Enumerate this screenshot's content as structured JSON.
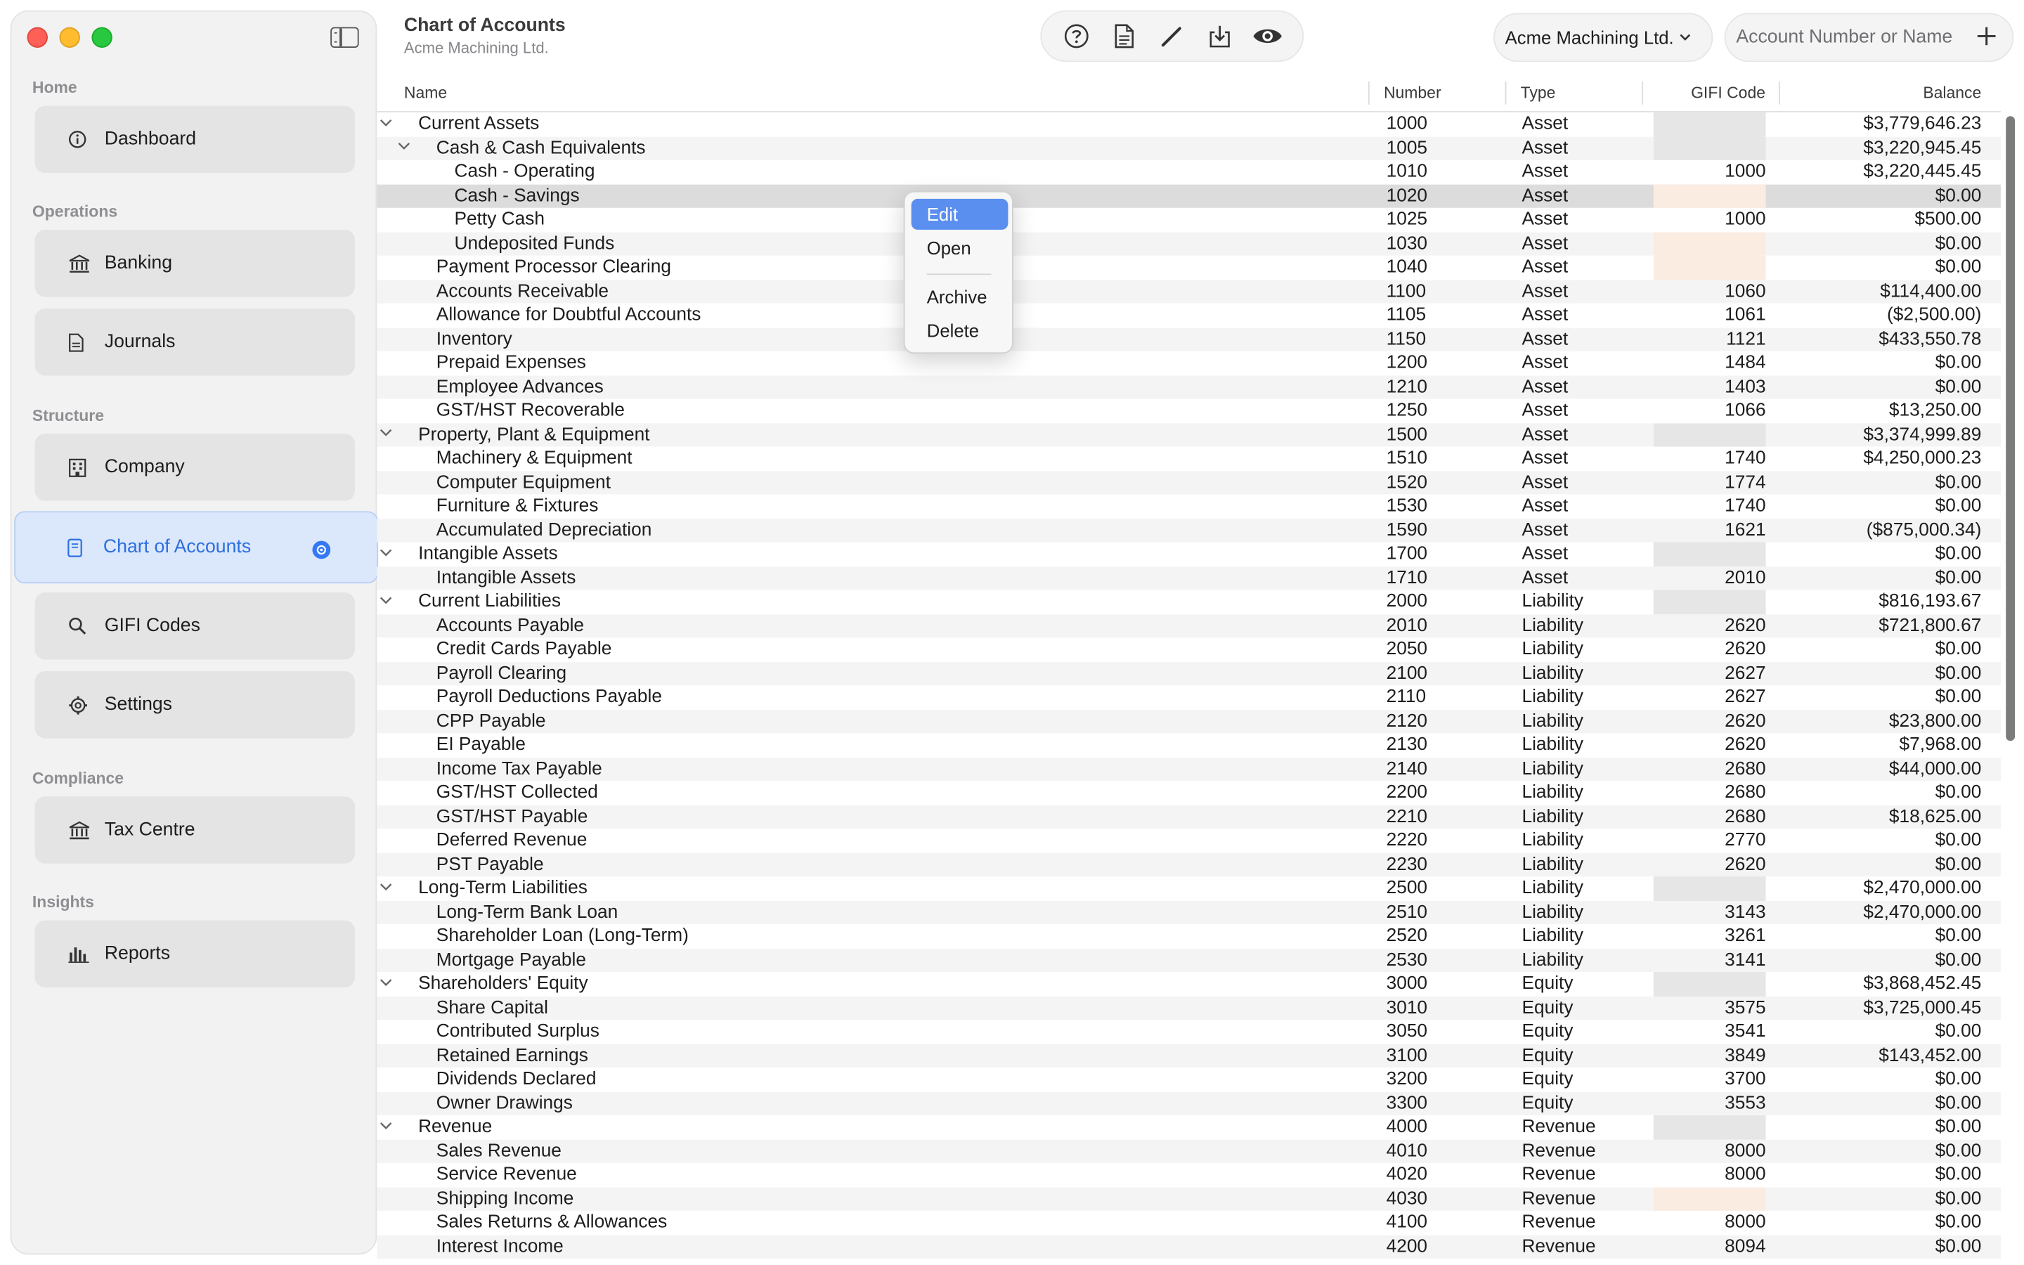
{
  "window": {
    "title": "Chart of Accounts",
    "subtitle": "Acme Machining Ltd."
  },
  "sidebar": {
    "sections": [
      {
        "label": "Home",
        "items": [
          {
            "label": "Dashboard",
            "icon": "info-circle-icon"
          }
        ]
      },
      {
        "label": "Operations",
        "items": [
          {
            "label": "Banking",
            "icon": "bank-icon"
          },
          {
            "label": "Journals",
            "icon": "document-icon"
          }
        ]
      },
      {
        "label": "Structure",
        "items": [
          {
            "label": "Company",
            "icon": "building-icon"
          },
          {
            "label": "Chart of Accounts",
            "icon": "book-icon",
            "active": true
          },
          {
            "label": "GIFI Codes",
            "icon": "search-icon"
          },
          {
            "label": "Settings",
            "icon": "gear-icon"
          }
        ]
      },
      {
        "label": "Compliance",
        "items": [
          {
            "label": "Tax Centre",
            "icon": "bank-icon"
          }
        ]
      },
      {
        "label": "Insights",
        "items": [
          {
            "label": "Reports",
            "icon": "bar-chart-icon"
          }
        ]
      }
    ]
  },
  "toolbar": {
    "buttons": [
      "help-icon",
      "document-icon",
      "pencil-icon",
      "download-icon",
      "eye-icon"
    ],
    "company": "Acme Machining Ltd.",
    "search_placeholder": "Account Number or Name"
  },
  "table": {
    "columns": {
      "name": "Name",
      "number": "Number",
      "type": "Type",
      "gifi": "GIFI Code",
      "balance": "Balance"
    },
    "rows": [
      {
        "name": "Current Assets",
        "level": 0,
        "expand": true,
        "number": "1000",
        "type": "Asset",
        "gifi": "",
        "gifi_state": "blank",
        "balance": "$3,779,646.23"
      },
      {
        "name": "Cash & Cash Equivalents",
        "level": 1,
        "expand": true,
        "number": "1005",
        "type": "Asset",
        "gifi": "",
        "gifi_state": "blank",
        "balance": "$3,220,945.45"
      },
      {
        "name": "Cash - Operating",
        "level": 2,
        "number": "1010",
        "type": "Asset",
        "gifi": "1000",
        "gifi_state": "",
        "balance": "$3,220,445.45"
      },
      {
        "name": "Cash - Savings",
        "level": 2,
        "number": "1020",
        "type": "Asset",
        "gifi": "",
        "gifi_state": "warn",
        "balance": "$0.00",
        "selected": true
      },
      {
        "name": "Petty Cash",
        "level": 2,
        "number": "1025",
        "type": "Asset",
        "gifi": "1000",
        "gifi_state": "",
        "balance": "$500.00"
      },
      {
        "name": "Undeposited Funds",
        "level": 2,
        "number": "1030",
        "type": "Asset",
        "gifi": "",
        "gifi_state": "warn",
        "balance": "$0.00"
      },
      {
        "name": "Payment Processor Clearing",
        "level": 1,
        "number": "1040",
        "type": "Asset",
        "gifi": "",
        "gifi_state": "warn",
        "balance": "$0.00"
      },
      {
        "name": "Accounts Receivable",
        "level": 1,
        "number": "1100",
        "type": "Asset",
        "gifi": "1060",
        "gifi_state": "",
        "balance": "$114,400.00"
      },
      {
        "name": "Allowance for Doubtful Accounts",
        "level": 1,
        "number": "1105",
        "type": "Asset",
        "gifi": "1061",
        "gifi_state": "",
        "balance": "($2,500.00)"
      },
      {
        "name": "Inventory",
        "level": 1,
        "number": "1150",
        "type": "Asset",
        "gifi": "1121",
        "gifi_state": "",
        "balance": "$433,550.78"
      },
      {
        "name": "Prepaid Expenses",
        "level": 1,
        "number": "1200",
        "type": "Asset",
        "gifi": "1484",
        "gifi_state": "",
        "balance": "$0.00"
      },
      {
        "name": "Employee Advances",
        "level": 1,
        "number": "1210",
        "type": "Asset",
        "gifi": "1403",
        "gifi_state": "",
        "balance": "$0.00"
      },
      {
        "name": "GST/HST Recoverable",
        "level": 1,
        "number": "1250",
        "type": "Asset",
        "gifi": "1066",
        "gifi_state": "",
        "balance": "$13,250.00"
      },
      {
        "name": "Property, Plant & Equipment",
        "level": 0,
        "expand": true,
        "number": "1500",
        "type": "Asset",
        "gifi": "",
        "gifi_state": "blank",
        "balance": "$3,374,999.89"
      },
      {
        "name": "Machinery & Equipment",
        "level": 1,
        "number": "1510",
        "type": "Asset",
        "gifi": "1740",
        "gifi_state": "",
        "balance": "$4,250,000.23"
      },
      {
        "name": "Computer Equipment",
        "level": 1,
        "number": "1520",
        "type": "Asset",
        "gifi": "1774",
        "gifi_state": "",
        "balance": "$0.00"
      },
      {
        "name": "Furniture & Fixtures",
        "level": 1,
        "number": "1530",
        "type": "Asset",
        "gifi": "1740",
        "gifi_state": "",
        "balance": "$0.00"
      },
      {
        "name": "Accumulated Depreciation",
        "level": 1,
        "number": "1590",
        "type": "Asset",
        "gifi": "1621",
        "gifi_state": "",
        "balance": "($875,000.34)"
      },
      {
        "name": "Intangible Assets",
        "level": 0,
        "expand": true,
        "number": "1700",
        "type": "Asset",
        "gifi": "",
        "gifi_state": "blank",
        "balance": "$0.00"
      },
      {
        "name": "Intangible Assets",
        "level": 1,
        "number": "1710",
        "type": "Asset",
        "gifi": "2010",
        "gifi_state": "",
        "balance": "$0.00"
      },
      {
        "name": "Current Liabilities",
        "level": 0,
        "expand": true,
        "number": "2000",
        "type": "Liability",
        "gifi": "",
        "gifi_state": "blank",
        "balance": "$816,193.67"
      },
      {
        "name": "Accounts Payable",
        "level": 1,
        "number": "2010",
        "type": "Liability",
        "gifi": "2620",
        "gifi_state": "",
        "balance": "$721,800.67"
      },
      {
        "name": "Credit Cards Payable",
        "level": 1,
        "number": "2050",
        "type": "Liability",
        "gifi": "2620",
        "gifi_state": "",
        "balance": "$0.00"
      },
      {
        "name": "Payroll Clearing",
        "level": 1,
        "number": "2100",
        "type": "Liability",
        "gifi": "2627",
        "gifi_state": "",
        "balance": "$0.00"
      },
      {
        "name": "Payroll Deductions Payable",
        "level": 1,
        "number": "2110",
        "type": "Liability",
        "gifi": "2627",
        "gifi_state": "",
        "balance": "$0.00"
      },
      {
        "name": "CPP Payable",
        "level": 1,
        "number": "2120",
        "type": "Liability",
        "gifi": "2620",
        "gifi_state": "",
        "balance": "$23,800.00"
      },
      {
        "name": "EI Payable",
        "level": 1,
        "number": "2130",
        "type": "Liability",
        "gifi": "2620",
        "gifi_state": "",
        "balance": "$7,968.00"
      },
      {
        "name": "Income Tax Payable",
        "level": 1,
        "number": "2140",
        "type": "Liability",
        "gifi": "2680",
        "gifi_state": "",
        "balance": "$44,000.00"
      },
      {
        "name": "GST/HST Collected",
        "level": 1,
        "number": "2200",
        "type": "Liability",
        "gifi": "2680",
        "gifi_state": "",
        "balance": "$0.00"
      },
      {
        "name": "GST/HST Payable",
        "level": 1,
        "number": "2210",
        "type": "Liability",
        "gifi": "2680",
        "gifi_state": "",
        "balance": "$18,625.00"
      },
      {
        "name": "Deferred Revenue",
        "level": 1,
        "number": "2220",
        "type": "Liability",
        "gifi": "2770",
        "gifi_state": "",
        "balance": "$0.00"
      },
      {
        "name": "PST Payable",
        "level": 1,
        "number": "2230",
        "type": "Liability",
        "gifi": "2620",
        "gifi_state": "",
        "balance": "$0.00"
      },
      {
        "name": "Long-Term Liabilities",
        "level": 0,
        "expand": true,
        "number": "2500",
        "type": "Liability",
        "gifi": "",
        "gifi_state": "blank",
        "balance": "$2,470,000.00"
      },
      {
        "name": "Long-Term Bank Loan",
        "level": 1,
        "number": "2510",
        "type": "Liability",
        "gifi": "3143",
        "gifi_state": "",
        "balance": "$2,470,000.00"
      },
      {
        "name": "Shareholder Loan (Long-Term)",
        "level": 1,
        "number": "2520",
        "type": "Liability",
        "gifi": "3261",
        "gifi_state": "",
        "balance": "$0.00"
      },
      {
        "name": "Mortgage Payable",
        "level": 1,
        "number": "2530",
        "type": "Liability",
        "gifi": "3141",
        "gifi_state": "",
        "balance": "$0.00"
      },
      {
        "name": "Shareholders' Equity",
        "level": 0,
        "expand": true,
        "number": "3000",
        "type": "Equity",
        "gifi": "",
        "gifi_state": "blank",
        "balance": "$3,868,452.45"
      },
      {
        "name": "Share Capital",
        "level": 1,
        "number": "3010",
        "type": "Equity",
        "gifi": "3575",
        "gifi_state": "",
        "balance": "$3,725,000.45"
      },
      {
        "name": "Contributed Surplus",
        "level": 1,
        "number": "3050",
        "type": "Equity",
        "gifi": "3541",
        "gifi_state": "",
        "balance": "$0.00"
      },
      {
        "name": "Retained Earnings",
        "level": 1,
        "number": "3100",
        "type": "Equity",
        "gifi": "3849",
        "gifi_state": "",
        "balance": "$143,452.00"
      },
      {
        "name": "Dividends Declared",
        "level": 1,
        "number": "3200",
        "type": "Equity",
        "gifi": "3700",
        "gifi_state": "",
        "balance": "$0.00"
      },
      {
        "name": "Owner Drawings",
        "level": 1,
        "number": "3300",
        "type": "Equity",
        "gifi": "3553",
        "gifi_state": "",
        "balance": "$0.00"
      },
      {
        "name": "Revenue",
        "level": 0,
        "expand": true,
        "number": "4000",
        "type": "Revenue",
        "gifi": "",
        "gifi_state": "blank",
        "balance": "$0.00"
      },
      {
        "name": "Sales Revenue",
        "level": 1,
        "number": "4010",
        "type": "Revenue",
        "gifi": "8000",
        "gifi_state": "",
        "balance": "$0.00"
      },
      {
        "name": "Service Revenue",
        "level": 1,
        "number": "4020",
        "type": "Revenue",
        "gifi": "8000",
        "gifi_state": "",
        "balance": "$0.00"
      },
      {
        "name": "Shipping Income",
        "level": 1,
        "number": "4030",
        "type": "Revenue",
        "gifi": "",
        "gifi_state": "warn",
        "balance": "$0.00"
      },
      {
        "name": "Sales Returns & Allowances",
        "level": 1,
        "number": "4100",
        "type": "Revenue",
        "gifi": "8000",
        "gifi_state": "",
        "balance": "$0.00"
      },
      {
        "name": "Interest Income",
        "level": 1,
        "number": "4200",
        "type": "Revenue",
        "gifi": "8094",
        "gifi_state": "",
        "balance": "$0.00"
      }
    ]
  },
  "context_menu": {
    "items": [
      {
        "label": "Edit",
        "highlighted": true
      },
      {
        "label": "Open"
      },
      {
        "label": "Archive"
      },
      {
        "label": "Delete"
      }
    ]
  },
  "colors": {
    "accent": "#3478f6",
    "active_bg": "#dbe7fb",
    "menu_highlight": "#5a8fef",
    "gifi_warning": "#fbece2"
  }
}
